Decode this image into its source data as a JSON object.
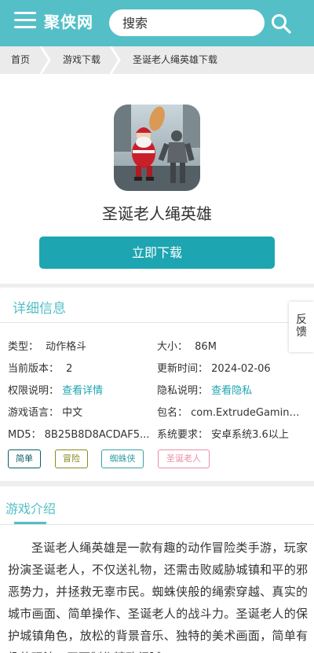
{
  "header": {
    "logo": "聚侠网",
    "search_placeholder": "搜索",
    "accent": "#54bfc7"
  },
  "breadcrumb": [
    "首页",
    "游戏下载",
    "圣诞老人绳英雄下载"
  ],
  "app": {
    "title": "圣诞老人绳英雄",
    "download_label": "立即下载",
    "icon": "santa-rope-hero-icon"
  },
  "details": {
    "section_title": "详细信息",
    "feedback": "反馈",
    "rows": [
      {
        "label": "类型：",
        "value": "动作格斗"
      },
      {
        "label": "大小：",
        "value": "86M"
      },
      {
        "label": "当前版本：",
        "value": "2"
      },
      {
        "label": "更新时间：",
        "value": "2024-02-06"
      },
      {
        "label": "权限说明：",
        "value": "查看详情"
      },
      {
        "label": "隐私说明：",
        "value": "查看隐私"
      },
      {
        "label": "游戏语言：",
        "value": "中文"
      },
      {
        "label": "包名：",
        "value": "com.ExtrudeGaming.SantaRopeHero"
      },
      {
        "label": "MD5：",
        "value": "8B25B8D8ACDAF5..."
      },
      {
        "label": "系统要求：",
        "value": "安卓系统3.6以上"
      }
    ],
    "tags": [
      {
        "label": "简单",
        "color": "#0b5d66"
      },
      {
        "label": "冒险",
        "color": "#8a8a1e"
      },
      {
        "label": "蜘蛛侠",
        "color": "#3aa0a8"
      },
      {
        "label": "圣诞老人",
        "color": "#e88fa5"
      }
    ]
  },
  "intro": {
    "section_title": "游戏介绍",
    "text": "圣诞老人绳英雄是一款有趣的动作冒险类手游，玩家扮演圣诞老人，不仅送礼物，还需击败威胁城镇和平的邪恶势力，并拯救无辜市民。蜘蛛侠般的绳索穿越、真实的城市画面、简单操作、圣诞老人的战斗力。圣诞老人的保护城镇角色，放松的背景音乐、独特的美术画面，简单有趣的玩法，画面制作精致细腻。"
  }
}
